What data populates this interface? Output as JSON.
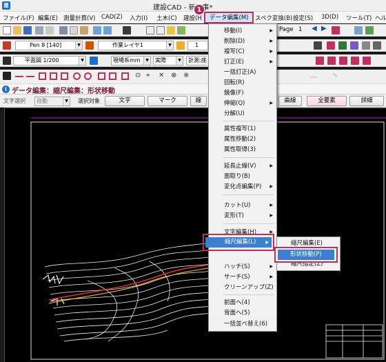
{
  "titlebar": {
    "title": "建設CAD - 新工事*"
  },
  "menubar": {
    "items": [
      {
        "label": "ファイル(F)"
      },
      {
        "label": "編集(E)"
      },
      {
        "label": "測量計算(V)"
      },
      {
        "label": "CAD(Z)"
      },
      {
        "label": "入力(I)"
      },
      {
        "label": "土木(C)"
      },
      {
        "label": "建設(H)"
      },
      {
        "label": "データ編集(M)"
      },
      {
        "label": "スペク変換(B)"
      },
      {
        "label": "設定(S)"
      },
      {
        "label": "3D(D)"
      },
      {
        "label": "ツール(T)"
      },
      {
        "label": "ヘル"
      }
    ]
  },
  "toolbar1": {
    "page_label": "Page",
    "page_value": "1"
  },
  "toolbar2": {
    "pen": "Pen 8 [140]",
    "layer": "作業レイヤ1",
    "linetype": "1"
  },
  "toolbar3": {
    "view": "平面図 1/200",
    "units": "現場系mm",
    "scale": "実際",
    "calc": "計測:座"
  },
  "modebar": {
    "title": "データ編集：縮尺編集：形状移動"
  },
  "optbar": {
    "text_select_label": "文字選択",
    "auto_value": "自動",
    "target_label": "選択対象",
    "buttons": [
      {
        "label": "文字"
      },
      {
        "label": "マーク"
      },
      {
        "label": "線"
      },
      {
        "label": "曲線"
      },
      {
        "label": "全要素"
      },
      {
        "label": "詳細"
      }
    ]
  },
  "data_menu": {
    "items": [
      {
        "label": "移動(I)",
        "submenu": true
      },
      {
        "label": "削除(D)",
        "submenu": true
      },
      {
        "label": "複写(C)",
        "submenu": true
      },
      {
        "label": "訂正(E)",
        "submenu": true
      },
      {
        "label": "一括訂正(A)"
      },
      {
        "label": "回転(R)"
      },
      {
        "label": "鏡像(F)"
      },
      {
        "label": "伸縮(Q)",
        "submenu": true
      },
      {
        "label": "分解(U)"
      },
      {
        "label": "属性複写(1)"
      },
      {
        "label": "属性移動(2)"
      },
      {
        "label": "属性取得(3)"
      },
      {
        "label": "延長止線(V)",
        "submenu": true
      },
      {
        "label": "面取り(B)"
      },
      {
        "label": "変化点編集(P)",
        "submenu": true
      },
      {
        "label": "カット(U)",
        "submenu": true
      },
      {
        "label": "変形(T)",
        "submenu": true
      },
      {
        "label": "文字編集(H)",
        "submenu": true
      },
      {
        "label": "縮尺編集(L)",
        "submenu": true
      },
      {
        "label": "ハッチ(S)",
        "submenu": true
      },
      {
        "label": "サーチ(S)",
        "submenu": true
      },
      {
        "label": "クリーンアップ(Z)"
      },
      {
        "label": "前面へ(4)"
      },
      {
        "label": "背面へ(5)"
      },
      {
        "label": "一括並べ替え(6)"
      }
    ]
  },
  "scale_submenu": {
    "items": [
      {
        "label": "縮尺編集(E)"
      },
      {
        "label": "形状移動(P)"
      },
      {
        "label": "縮尺指定(Z)"
      }
    ]
  },
  "callout": {
    "badge": "1"
  },
  "colors": {
    "highlight": "#3a7fd0",
    "callout": "#c42a5a",
    "canvas": "#000000"
  },
  "icons": [
    "new-icon",
    "open-icon",
    "save-icon",
    "print-icon",
    "cut-icon",
    "copy-icon",
    "paste-icon",
    "undo-icon",
    "redo-icon",
    "zoom-icon",
    "help-pointer-icon",
    "pen-icon",
    "layer-icon",
    "snap-icon",
    "info-icon"
  ]
}
